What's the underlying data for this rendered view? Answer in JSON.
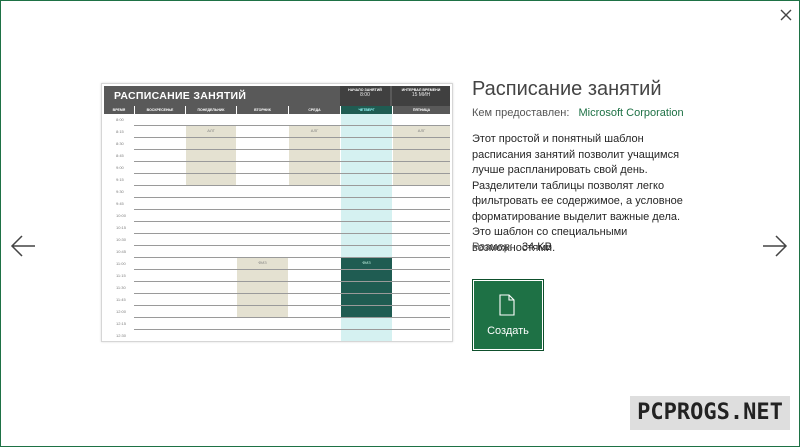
{
  "template": {
    "title": "Расписание занятий",
    "provider_label": "Кем предоставлен:",
    "provider_value": "Microsoft Corporation",
    "description": "Этот простой и понятный шаблон расписания занятий позволит учащимся лучше распланировать свой день. Разделители таблицы позволят легко фильтровать ее содержимое, а условное форматирование выделит важные дела. Это шаблон со специальными возможностями.",
    "size_label": "Размер:",
    "size_value": "34 KB",
    "create_label": "Создать"
  },
  "preview": {
    "title": "РАСПИСАНИЕ ЗАНЯТИЙ",
    "box1_label": "НАЧАЛО ЗАНЯТИЙ",
    "box1_value": "8:00",
    "box2_label": "ИНТЕРВАЛ ВРЕМЕНИ",
    "box2_value": "15 МИН",
    "days": [
      "ВРЕМЯ",
      "ВОСКРЕСЕНЬЕ",
      "ПОНЕДЕЛЬНИК",
      "ВТОРНИК",
      "СРЕДА",
      "ЧЕТВЕРГ",
      "ПЯТНИЦА"
    ],
    "times": [
      "8:00",
      "8:15",
      "8:30",
      "8:45",
      "9:00",
      "9:15",
      "9:30",
      "9:45",
      "10:00",
      "10:15",
      "10:30",
      "10:45",
      "11:00",
      "11:15",
      "11:30",
      "11:45",
      "12:00",
      "12:15",
      "12:30"
    ],
    "block_labels": {
      "mon": "АЛГ",
      "wed": "АЛГ",
      "fri": "АЛГ",
      "tue": "ФИЗ",
      "thu": "ФИЗ"
    }
  },
  "colors": {
    "accent": "#1e7145",
    "block": "#e4e1d1",
    "thursday_col": "#d5f1f1",
    "thursday_block": "#1f5c52"
  },
  "icons": {
    "close": "close-icon",
    "prev": "arrow-left-icon",
    "next": "arrow-right-icon",
    "create": "document-icon"
  },
  "watermark": "PCPROGS.NET"
}
